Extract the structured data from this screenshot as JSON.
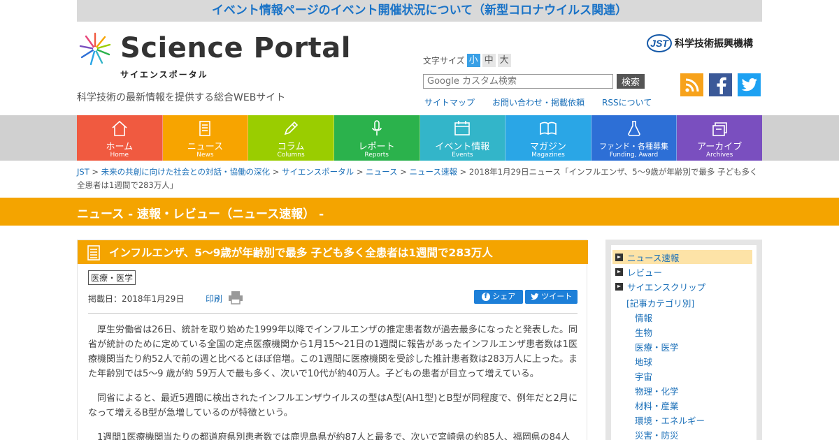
{
  "notice": "イベント情報ページのイベント開催状況について（新型コロナウイルス関連）",
  "logo": {
    "title": "Science Portal",
    "kana": "サイエンスポータル"
  },
  "tagline": "科学技術の最新情報を提供する総合WEBサイト",
  "jst": {
    "mark": "JST",
    "name": "科学技術振興機構"
  },
  "fontsize": {
    "label": "文字サイズ",
    "small": "小",
    "medium": "中",
    "large": "大"
  },
  "search": {
    "placeholder": "Google カスタム検索",
    "button": "検索"
  },
  "toplinks": {
    "sitemap": "サイトマップ",
    "contact": "お問い合わせ・掲載依頼",
    "rss": "RSSについて"
  },
  "nav": [
    {
      "jp": "ホーム",
      "en": "Home",
      "color": "#f05a40"
    },
    {
      "jp": "ニュース",
      "en": "News",
      "color": "#f7a400"
    },
    {
      "jp": "コラム",
      "en": "Columns",
      "color": "#9acd00"
    },
    {
      "jp": "レポート",
      "en": "Reports",
      "color": "#2bb24c"
    },
    {
      "jp": "イベント情報",
      "en": "Events",
      "color": "#33b5c9"
    },
    {
      "jp": "マガジン",
      "en": "Magazines",
      "color": "#2aa6e6"
    },
    {
      "jp": "ファンド・各種募集",
      "en": "Funding, Award",
      "color": "#2d6fd6"
    },
    {
      "jp": "アーカイブ",
      "en": "Archives",
      "color": "#7a4fbf"
    }
  ],
  "breadcrumb": {
    "items": [
      "JST",
      "未来の共創に向けた社会との対話・協働の深化",
      "サイエンスポータル",
      "ニュース",
      "ニュース速報"
    ],
    "current": "2018年1月29日ニュース「インフルエンザ、5～9歳が年齢別で最多 子ども多く全患者は1週間で283万人」"
  },
  "category_band": "ニュース - 速報・レビュー（ニュース速報） -",
  "article": {
    "title": "インフルエンザ、5～9歳が年齢別で最多 子ども多く全患者は1週間で283万人",
    "tag": "医療・医学",
    "date": "掲載日：2018年1月29日",
    "print": "印刷",
    "share_fb": "シェア",
    "share_tw": "ツイート",
    "paragraphs": [
      "厚生労働省は26日、統計を取り始めた1999年以降でインフルエンザの推定患者数が過去最多になったと発表した。同省が統計のために定めている全国の定点医療機関から1月15～21日の1週間に報告があったインフルエンザ患者数は1医療機関当たり約52人で前の週と比べるとほぼ倍増。この1週間に医療機関を受診した推計患者数は283万人に上った。また年齢別では5～9 歳が約 59万人で最も多く、次いで10代が約40万人。子どもの患者が目立って増えている。",
      "同省によると、最近5週間に検出されたインフルエンザウイルスの型はA型(AH1型)とB型が同程度で、例年だと2月になって増えるB型が急増しているのが特徴という。",
      "1週間1医療機関当たりの都道府県別患者数では鹿児島県が約87人と最多で、次いで宮崎県の約85人、福岡県の84人"
    ]
  },
  "sidebar": {
    "main": [
      "ニュース速報",
      "レビュー",
      "サイエンスクリップ"
    ],
    "category_label": "[記事カテゴリ別]",
    "categories": [
      "情報",
      "生物",
      "医療・医学",
      "地球",
      "宇宙",
      "物理・化学",
      "材料・産業",
      "環境・エネルギー",
      "災害・防災"
    ]
  }
}
